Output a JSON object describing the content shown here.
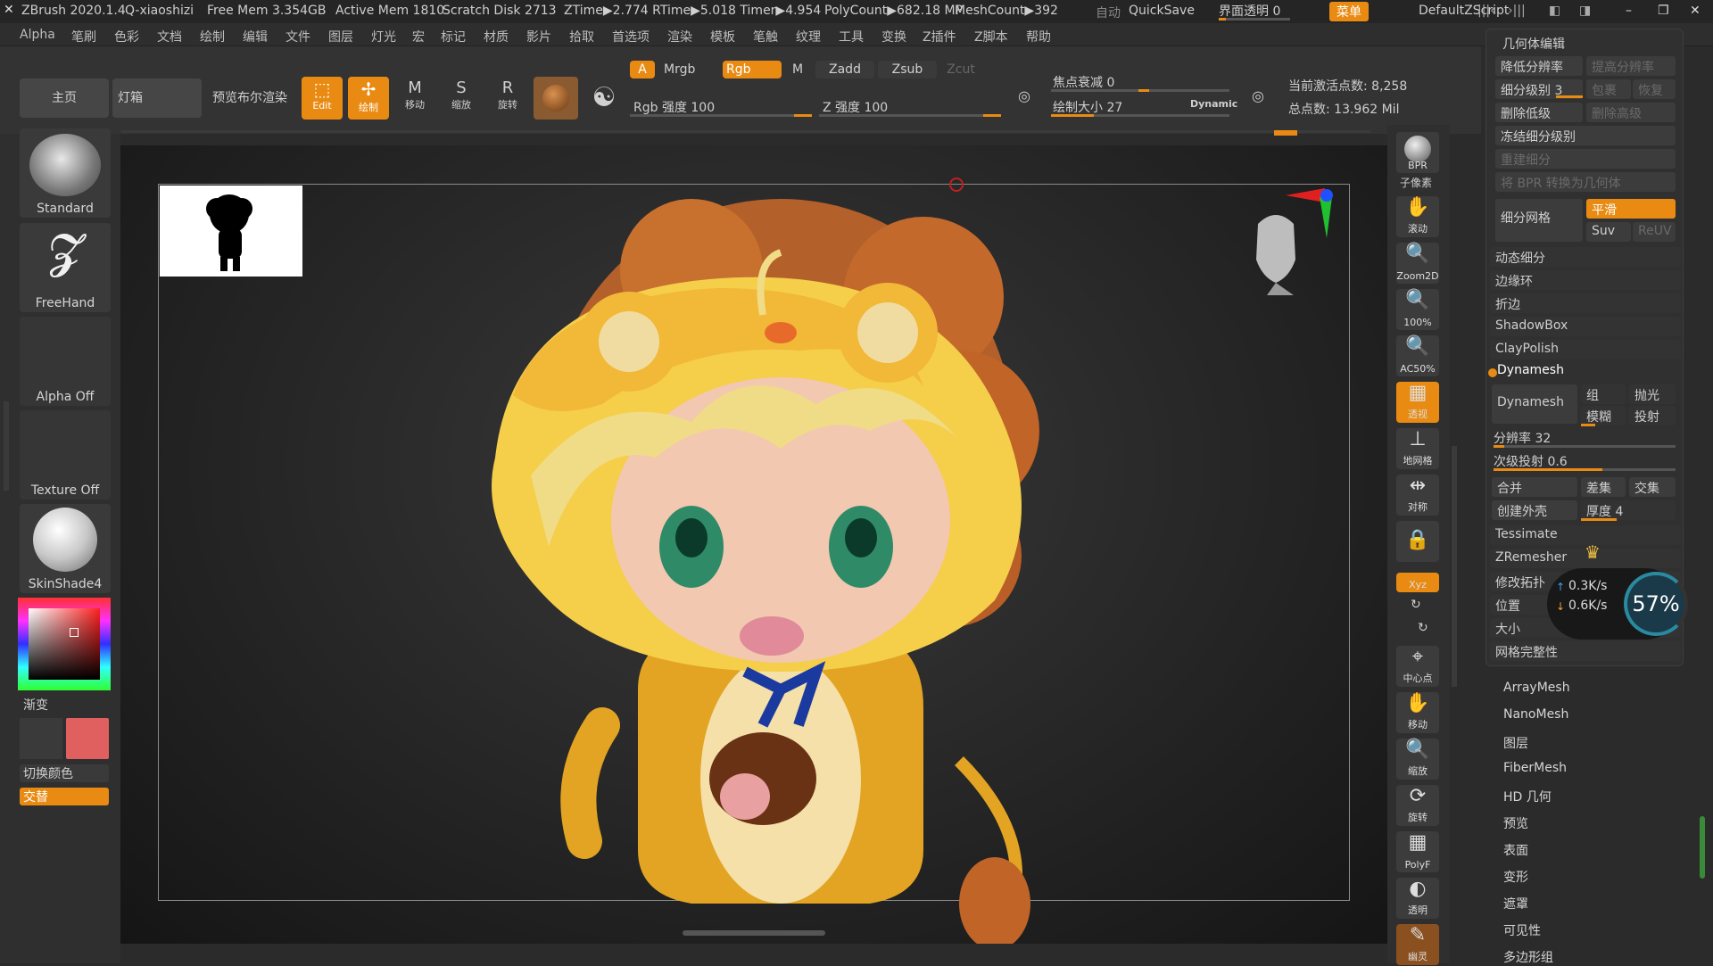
{
  "title": {
    "app": "ZBrush 2020.1.4",
    "user": "Q-xiaoshizi",
    "free_mem": "Free Mem 3.354GB",
    "active_mem": "Active Mem 1810",
    "scratch": "Scratch Disk 2713",
    "ztime": "ZTime▶2.774 RTime▶5.018 Timer▶4.954",
    "polycount": "PolyCount▶682.18 MP",
    "meshcount": "MeshCount▶392",
    "auto": "自动",
    "quicksave": "QuickSave",
    "transparency": "界面透明 0",
    "menu": "菜单",
    "script": "DefaultZScript"
  },
  "menu": [
    "Alpha",
    "笔刷",
    "色彩",
    "文档",
    "绘制",
    "编辑",
    "文件",
    "图层",
    "灯光",
    "宏",
    "标记",
    "材质",
    "影片",
    "拾取",
    "首选项",
    "渲染",
    "模板",
    "笔触",
    "纹理",
    "工具",
    "变换",
    "Z插件",
    "Z脚本",
    "帮助"
  ],
  "toolbar": {
    "home": "主页",
    "lightbox": "灯箱",
    "bpr_preview": "预览布尔渲染",
    "edit": "Edit",
    "draw": "绘制",
    "move": "移动",
    "scale": "缩放",
    "rotate": "旋转",
    "a": "A",
    "mrgb": "Mrgb",
    "rgb": "Rgb",
    "m": "M",
    "zadd": "Zadd",
    "zsub": "Zsub",
    "zcut": "Zcut",
    "rgb_intensity": "Rgb 强度 100",
    "z_intensity": "Z 强度 100",
    "focal_shift": "焦点衰减 0",
    "draw_size": "绘制大小 27",
    "dynamic": "Dynamic",
    "active_points": "当前激活点数: 8,258",
    "total_points": "总点数: 13.962 Mil"
  },
  "leftshelf": {
    "brush": "Standard",
    "stroke": "FreeHand",
    "alpha": "Alpha Off",
    "texture": "Texture Off",
    "material": "SkinShade4",
    "gradient": "渐变",
    "switch_color": "切换颜色",
    "alternate": "交替",
    "main_color": "#e06060"
  },
  "rightshelf": [
    "BPR",
    "子像素",
    "滚动",
    "Zoom2D",
    "100%",
    "AC50%",
    "透视",
    "地网格",
    "对称",
    "",
    "Xyz",
    "",
    "",
    "中心点",
    "移动",
    "缩放",
    "旋转",
    "PolyF",
    "透明",
    "幽灵"
  ],
  "panel": {
    "header": "几何体编辑",
    "lower_res": "降低分辨率",
    "higher_res": "提高分辨率",
    "sdiv": "细分级别 3",
    "cage": "包裹",
    "restore": "恢复",
    "del_lower": "删除低级",
    "del_higher": "删除高级",
    "freeze": "冻结细分级别",
    "reconstruct": "重建细分",
    "bpr_to_geo": "将 BPR 转换为几何体",
    "divide": "细分网格",
    "smooth": "平滑",
    "suv": "Suv",
    "reuv": "ReUV",
    "dynamic_sub": "动态细分",
    "edgeloop": "边缘环",
    "crease": "折边",
    "shadowbox": "ShadowBox",
    "claypolish": "ClayPolish",
    "dynamesh_section": "Dynamesh",
    "dynamesh_btn": "Dynamesh",
    "groups": "组",
    "polish": "抛光",
    "blur": "模糊",
    "project": "投射",
    "resolution": "分辨率 32",
    "subproject": "次级投射 0.6",
    "add": "合并",
    "sub": "差集",
    "intersect": "交集",
    "create_shell": "创建外壳",
    "thickness": "厚度 4",
    "tessimate": "Tessimate",
    "zremesher": "ZRemesher",
    "modify_topo": "修改拓扑",
    "position": "位置",
    "size": "大小",
    "mesh_integrity": "网格完整性",
    "net_up": "0.3K/s",
    "net_down": "0.6K/s",
    "cpu": "57%"
  },
  "subpanels": [
    "ArrayMesh",
    "NanoMesh",
    "图层",
    "FiberMesh",
    "HD 几何",
    "预览",
    "表面",
    "变形",
    "遮罩",
    "可见性",
    "多边形组"
  ]
}
